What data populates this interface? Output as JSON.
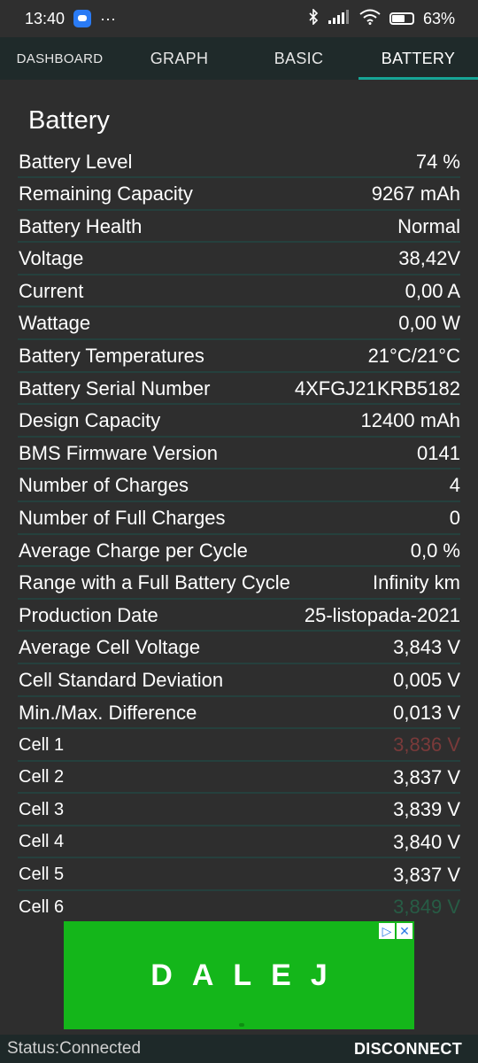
{
  "statusbar": {
    "time": "13:40",
    "dots": "···",
    "battery_percent": "63%",
    "battery_level_fraction": 0.63,
    "icons": [
      "bluetooth-icon",
      "signal-icon",
      "wifi-icon",
      "battery-icon"
    ]
  },
  "tabs": [
    {
      "label": "DASHBOARD",
      "active": false
    },
    {
      "label": "GRAPH",
      "active": false
    },
    {
      "label": "BASIC",
      "active": false
    },
    {
      "label": "BATTERY",
      "active": true
    }
  ],
  "panel": {
    "title": "Battery",
    "rows": [
      {
        "label": "Battery Level",
        "value": "74 %"
      },
      {
        "label": "Remaining Capacity",
        "value": "9267 mAh"
      },
      {
        "label": "Battery Health",
        "value": "Normal"
      },
      {
        "label": "Voltage",
        "value": "38,42V"
      },
      {
        "label": "Current",
        "value": "0,00 A"
      },
      {
        "label": "Wattage",
        "value": "0,00 W"
      },
      {
        "label": "Battery Temperatures",
        "value": "21°C/21°C"
      },
      {
        "label": "Battery Serial Number",
        "value": "4XFGJ21KRB5182"
      },
      {
        "label": "Design Capacity",
        "value": "12400 mAh"
      },
      {
        "label": "BMS Firmware Version",
        "value": "0141"
      },
      {
        "label": "Number of Charges",
        "value": "4"
      },
      {
        "label": "Number of Full Charges",
        "value": "0"
      },
      {
        "label": "Average Charge per Cycle",
        "value": "0,0 %"
      },
      {
        "label": "Range with a Full Battery Cycle",
        "value": "Infinity km"
      },
      {
        "label": "Production Date",
        "value": "25-listopada-2021"
      },
      {
        "label": "Average Cell Voltage",
        "value": "3,843 V"
      },
      {
        "label": "Cell Standard Deviation",
        "value": "0,005 V"
      },
      {
        "label": "Min./Max. Difference",
        "value": "0,013 V"
      },
      {
        "label": "Cell 1",
        "value": "3,836 V",
        "color": "#7a3a3a"
      },
      {
        "label": "Cell 2",
        "value": "3,837 V"
      },
      {
        "label": "Cell 3",
        "value": "3,839 V"
      },
      {
        "label": "Cell 4",
        "value": "3,840 V"
      },
      {
        "label": "Cell 5",
        "value": "3,837 V"
      },
      {
        "label": "Cell 6",
        "value": "3,849 V",
        "color": "#275c45"
      }
    ]
  },
  "ad": {
    "text": "DALEJ",
    "background": "#14b61a",
    "icons": [
      "adchoices-icon",
      "close-icon"
    ]
  },
  "bottom": {
    "status": "Status:Connected",
    "disconnect_label": "DISCONNECT"
  },
  "colors": {
    "accent": "#16a596",
    "row_divider": "#25403d",
    "tab_bar": "#1f2a2a",
    "background": "#2e2e2e"
  }
}
